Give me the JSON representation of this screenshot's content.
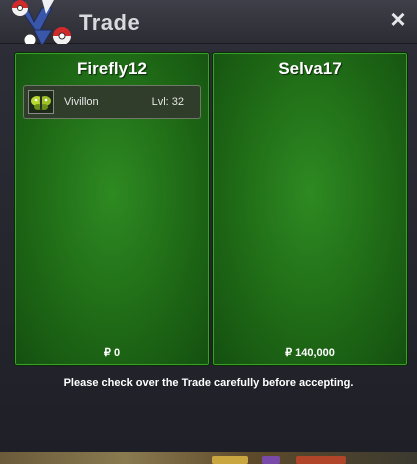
{
  "window": {
    "title": "Trade",
    "close_label": "×"
  },
  "trader_left": {
    "name": "Firefly12",
    "items": [
      {
        "name": "Vivillon",
        "level": "Lvl: 32",
        "icon": "vivillon-icon"
      }
    ],
    "money": "₽ 0"
  },
  "trader_right": {
    "name": "Selva17",
    "items": [],
    "money": "₽ 140,000"
  },
  "notice": "Please check over the Trade carefully before accepting.",
  "colors": {
    "panel_green": "#1f6a16",
    "window_dark": "#26262e",
    "title_text": "#d9d9de"
  }
}
